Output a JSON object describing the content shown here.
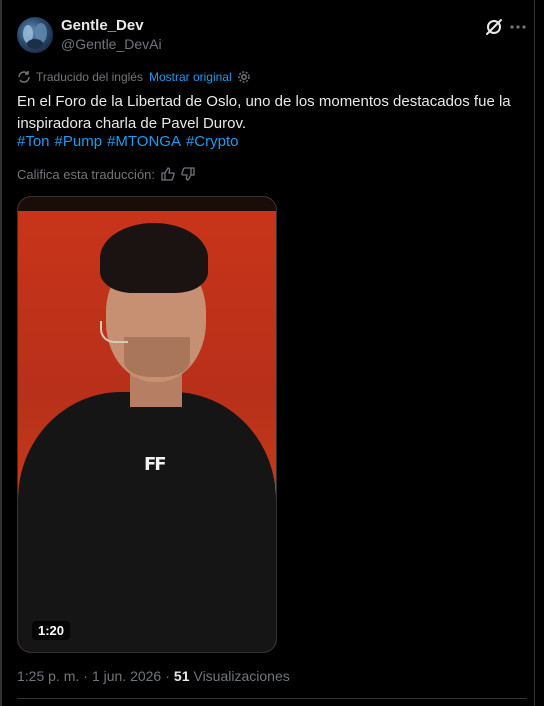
{
  "author": {
    "name": "Gentle_Dev",
    "handle": "@Gentle_DevAi"
  },
  "translation": {
    "label": "Traducido del inglés",
    "show_original": "Mostrar original"
  },
  "tweet": {
    "text": "En el Foro de la Libertad de Oslo, uno de los momentos destacados fue la inspiradora charla de Pavel Durov.",
    "hashtags": [
      "#Ton",
      "#Pump",
      "#MTONGA",
      "#Crypto"
    ]
  },
  "rating": {
    "label": "Califica esta traducción:"
  },
  "media": {
    "duration": "1:20",
    "shirt_logo": "FF"
  },
  "meta": {
    "time": "1:25 p. m.",
    "separator": "·",
    "date": "1 jun. 2026",
    "views_count": "51",
    "views_label": "Visualizaciones"
  },
  "icons": {
    "grok": "grok-icon",
    "more": "more-icon",
    "translate": "translate-icon",
    "settings": "gear-icon",
    "thumbs_up": "thumbs-up-icon",
    "thumbs_down": "thumbs-down-icon"
  },
  "colors": {
    "accent": "#1d9bf0",
    "muted": "#71767b",
    "text": "#e7e9ea",
    "background": "#000000"
  }
}
